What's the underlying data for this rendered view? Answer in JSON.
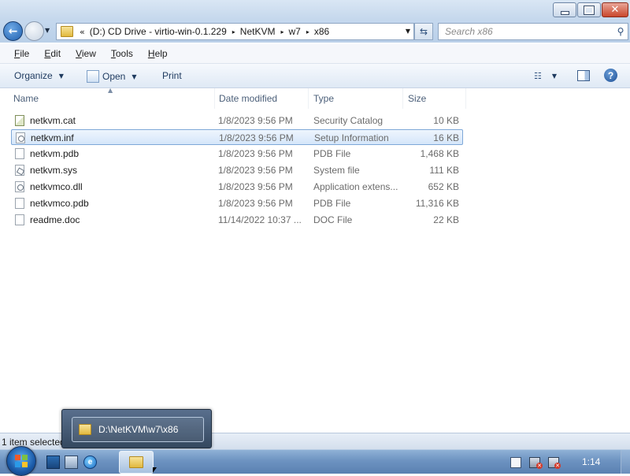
{
  "window": {
    "caption_buttons": {
      "minimize": "minimize-icon",
      "maximize": "maximize-icon",
      "close": "close-icon"
    }
  },
  "address": {
    "overflow": "«",
    "crumbs": [
      "(D:) CD Drive - virtio-win-0.1.229",
      "NetKVM",
      "w7",
      "x86"
    ],
    "separator": "▸"
  },
  "search": {
    "placeholder": "Search x86"
  },
  "menu": {
    "items": [
      {
        "mn": "F",
        "rest": "ile"
      },
      {
        "mn": "E",
        "rest": "dit"
      },
      {
        "mn": "V",
        "rest": "iew"
      },
      {
        "mn": "T",
        "rest": "ools"
      },
      {
        "mn": "H",
        "rest": "elp"
      }
    ]
  },
  "toolbar": {
    "organize": "Organize",
    "open": "Open",
    "print": "Print",
    "help": "?"
  },
  "columns": {
    "name": "Name",
    "date": "Date modified",
    "type": "Type",
    "size": "Size"
  },
  "files": [
    {
      "name": "netkvm.cat",
      "date": "1/8/2023 9:56 PM",
      "type": "Security Catalog",
      "size": "10 KB",
      "icon": "catalog-file-icon",
      "selected": false
    },
    {
      "name": "netkvm.inf",
      "date": "1/8/2023 9:56 PM",
      "type": "Setup Information",
      "size": "16 KB",
      "icon": "setup-info-file-icon",
      "selected": true
    },
    {
      "name": "netkvm.pdb",
      "date": "1/8/2023 9:56 PM",
      "type": "PDB File",
      "size": "1,468 KB",
      "icon": "generic-file-icon",
      "selected": false
    },
    {
      "name": "netkvm.sys",
      "date": "1/8/2023 9:56 PM",
      "type": "System file",
      "size": "111 KB",
      "icon": "system-file-icon",
      "selected": false
    },
    {
      "name": "netkvmco.dll",
      "date": "1/8/2023 9:56 PM",
      "type": "Application extens...",
      "size": "652 KB",
      "icon": "dll-file-icon",
      "selected": false
    },
    {
      "name": "netkvmco.pdb",
      "date": "1/8/2023 9:56 PM",
      "type": "PDB File",
      "size": "11,316 KB",
      "icon": "generic-file-icon",
      "selected": false
    },
    {
      "name": "readme.doc",
      "date": "11/14/2022 10:37 ...",
      "type": "DOC File",
      "size": "22 KB",
      "icon": "generic-file-icon",
      "selected": false
    }
  ],
  "status": {
    "text": "1 item selected"
  },
  "thumbnail": {
    "label": "D:\\NetKVM\\w7\\x86"
  },
  "taskbar": {
    "clock": "1:14",
    "ie_glyph": "e"
  },
  "colors": {
    "selection_fill": "#d5e6fa",
    "selection_border": "#7ea8d8",
    "taskbar": "#6d93c1"
  }
}
